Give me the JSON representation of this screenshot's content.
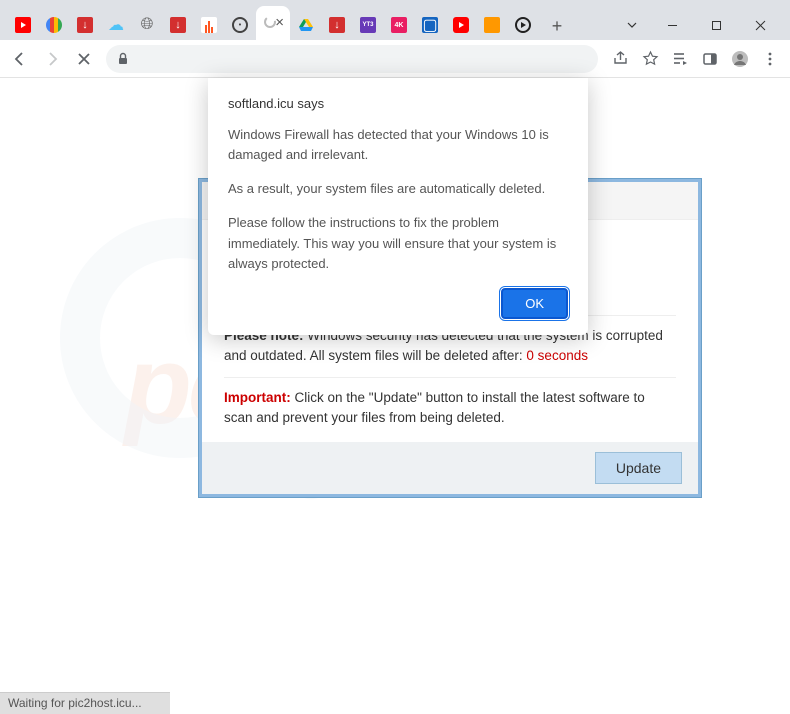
{
  "window": {
    "tabs": [
      {
        "icon": "youtube",
        "color": "#ff0000"
      },
      {
        "icon": "google",
        "color": "#4285f4"
      },
      {
        "icon": "download",
        "color": "#d32f2f"
      },
      {
        "icon": "cloud",
        "color": "#4fc3f7"
      },
      {
        "icon": "globe",
        "color": "#616161"
      },
      {
        "icon": "download2",
        "color": "#d32f2f"
      },
      {
        "icon": "bars",
        "color": "#ff5722"
      },
      {
        "icon": "circle",
        "color": "#424242"
      },
      {
        "icon": "active",
        "label": "×"
      },
      {
        "icon": "drive",
        "color": "#0f9d58"
      },
      {
        "icon": "download3",
        "color": "#d32f2f"
      },
      {
        "icon": "yt3",
        "color": "#673ab7"
      },
      {
        "icon": "4k",
        "color": "#e91e63"
      },
      {
        "icon": "tv",
        "color": "#1565c0"
      },
      {
        "icon": "ytplay",
        "color": "#ff0000"
      },
      {
        "icon": "orange",
        "color": "#ff9800"
      },
      {
        "icon": "play",
        "color": "#212121"
      }
    ],
    "newtab_label": "+"
  },
  "toolbar": {
    "share_icon": "share",
    "star_icon": "star",
    "list_icon": "list",
    "panel_icon": "panel",
    "profile_icon": "profile",
    "menu_icon": "menu"
  },
  "alert": {
    "title": "softland.icu says",
    "p1": "Windows Firewall has detected that your Windows 10 is damaged and irrelevant.",
    "p2": "As a result, your system files are automatically deleted.",
    "p3": "Please follow the instructions to fix the problem immediately. This way you will ensure that your system is always protected.",
    "ok_label": "OK"
  },
  "scam": {
    "note_label": "Please note:",
    "note_text": " Windows security has detected that the system is corrupted and outdated. All system files will be deleted after: ",
    "note_countdown": "0 seconds",
    "important_label": "Important:",
    "important_text": " Click on the \"Update\" button to install the latest software to scan and prevent your files from being deleted.",
    "update_label": "Update"
  },
  "statusbar": {
    "text": "Waiting for pic2host.icu..."
  },
  "watermark": {
    "text": "pcrisk.com"
  }
}
